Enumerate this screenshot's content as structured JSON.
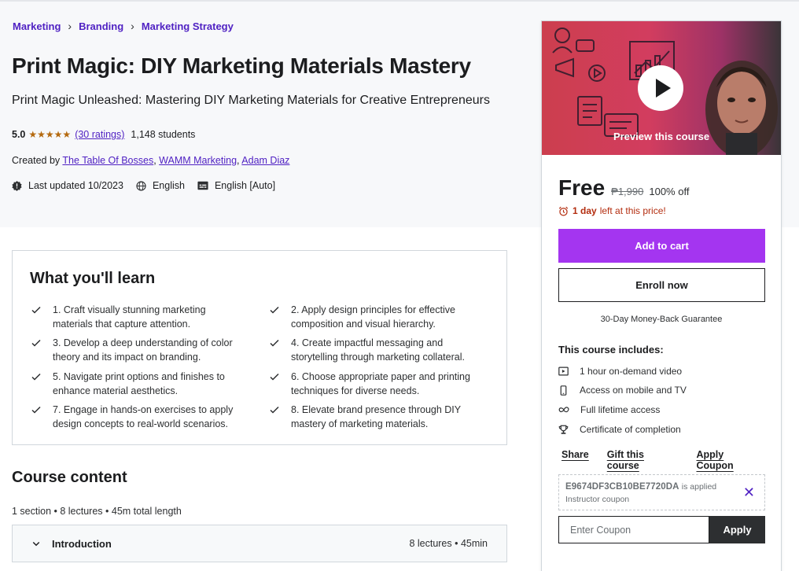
{
  "breadcrumb": [
    "Marketing",
    "Branding",
    "Marketing Strategy"
  ],
  "course": {
    "title": "Print Magic: DIY Marketing Materials Mastery",
    "subtitle": "Print Magic Unleashed: Mastering DIY Marketing Materials for Creative Entrepreneurs",
    "rating": "5.0",
    "stars": "★★★★★",
    "ratings_count": "(30 ratings)",
    "students": "1,148 students",
    "created_by_label": "Created by",
    "instructors": [
      "The Table Of Bosses",
      "WAMM Marketing",
      "Adam Diaz"
    ],
    "last_updated": "Last updated 10/2023",
    "language": "English",
    "captions": "English [Auto]"
  },
  "learn": {
    "title": "What you'll learn",
    "items": [
      "1. Craft visually stunning marketing materials that capture attention.",
      "2. Apply design principles for effective composition and visual hierarchy.",
      "3. Develop a deep understanding of color theory and its impact on branding.",
      "4. Create impactful messaging and storytelling through marketing collateral.",
      "5. Navigate print options and finishes to enhance material aesthetics.",
      "6. Choose appropriate paper and printing techniques for diverse needs.",
      "7. Engage in hands-on exercises to apply design concepts to real-world scenarios.",
      "8. Elevate brand presence through DIY mastery of marketing materials."
    ]
  },
  "content": {
    "title": "Course content",
    "meta": "1 section • 8 lectures • 45m total length",
    "sections": [
      {
        "name": "Introduction",
        "meta": "8 lectures • 45min"
      }
    ]
  },
  "sidebar": {
    "preview_label": "Preview this course",
    "price_now": "Free",
    "price_old": "₱1,990",
    "price_off": "100% off",
    "timer_bold": "1 day",
    "timer_rest": "left at this price!",
    "add_to_cart": "Add to cart",
    "enroll_now": "Enroll now",
    "guarantee": "30-Day Money-Back Guarantee",
    "includes_title": "This course includes:",
    "includes": [
      {
        "icon": "video-icon",
        "text": "1 hour on-demand video"
      },
      {
        "icon": "mobile-icon",
        "text": "Access on mobile and TV"
      },
      {
        "icon": "infinity-icon",
        "text": "Full lifetime access"
      },
      {
        "icon": "trophy-icon",
        "text": "Certificate of completion"
      }
    ],
    "links": [
      "Share",
      "Gift this course",
      "Apply Coupon"
    ],
    "coupon_code": "E9674DF3CB10BE7720DA",
    "coupon_applied": "is applied",
    "coupon_sub": "Instructor coupon",
    "coupon_placeholder": "Enter Coupon",
    "apply": "Apply"
  },
  "colors": {
    "accent": "#a435f0",
    "link": "#5022c3",
    "stars": "#b4690e",
    "timer": "#b32d0f",
    "dark": "#2d2f31"
  }
}
